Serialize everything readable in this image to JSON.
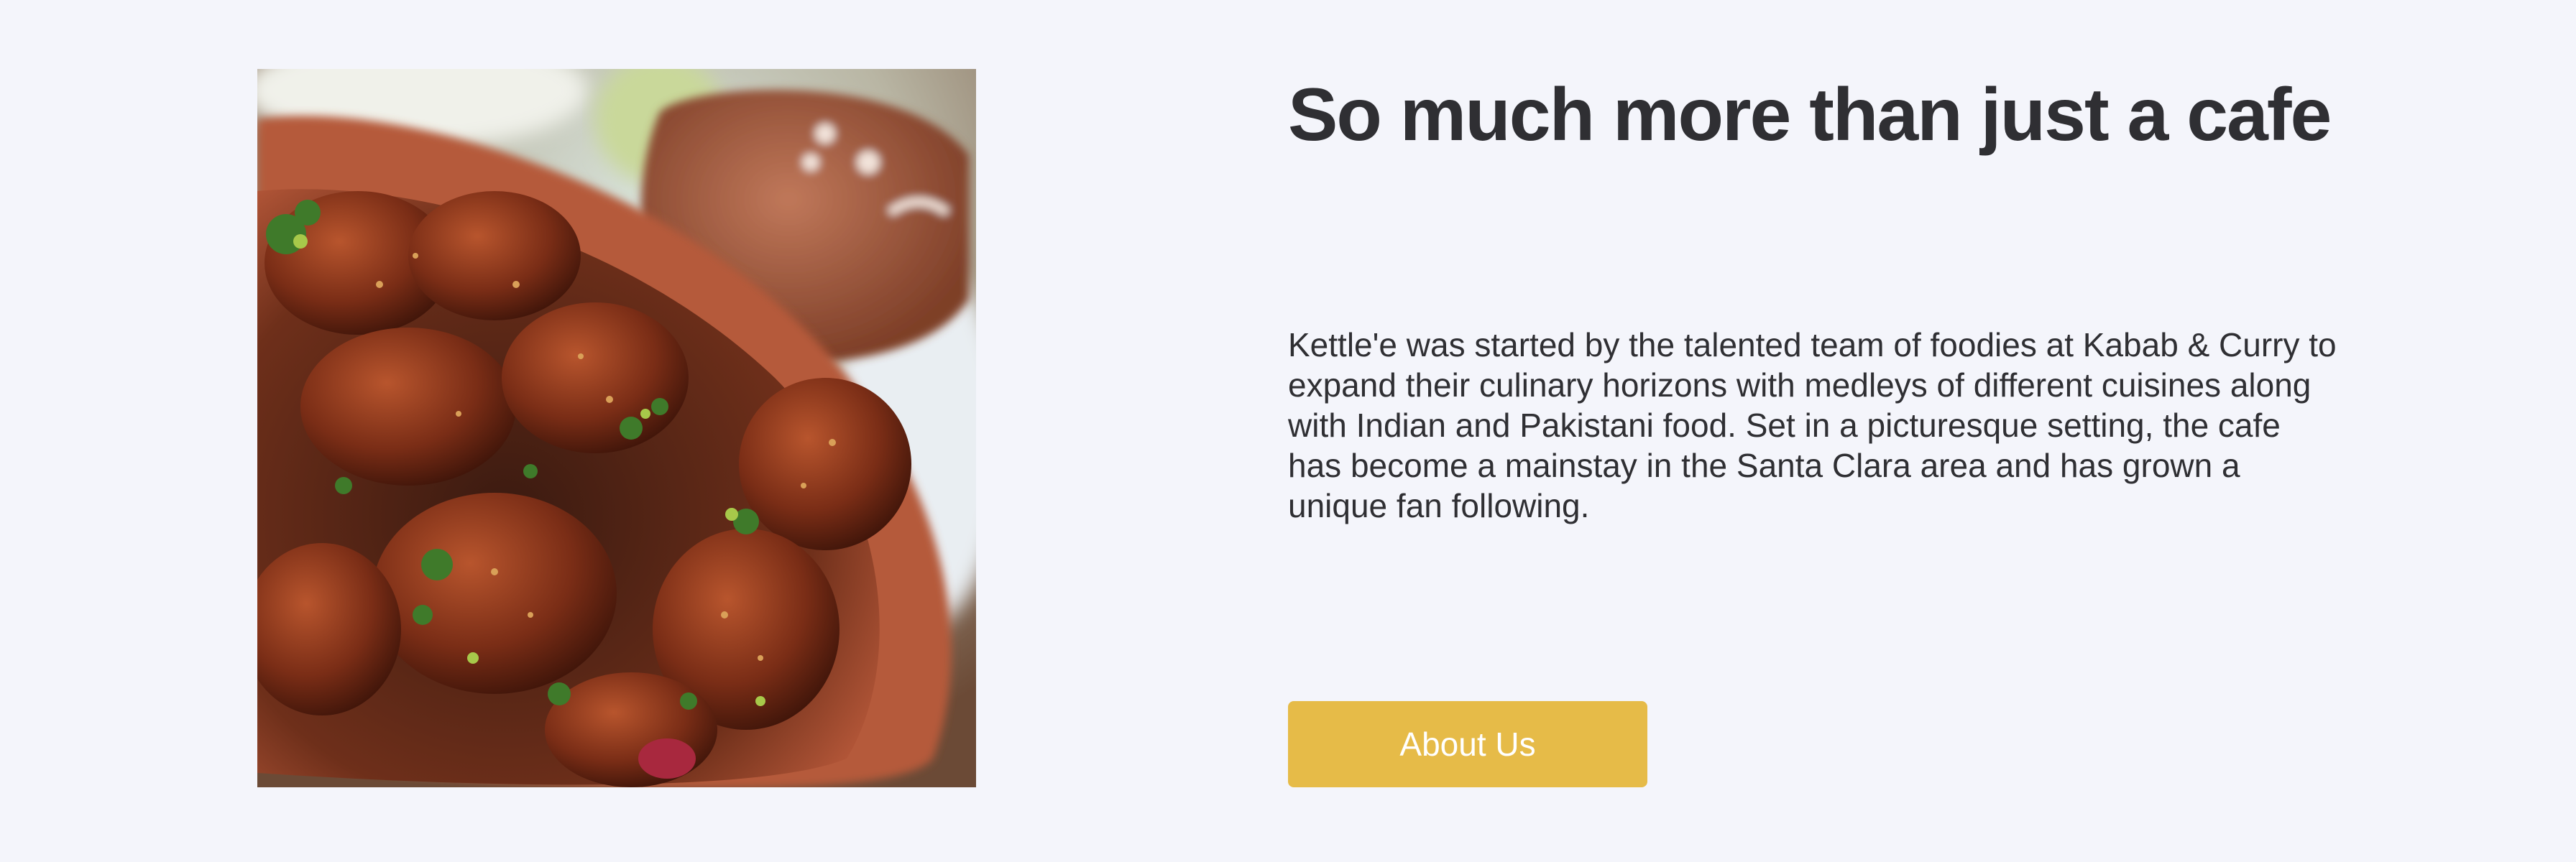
{
  "feature": {
    "image_alt": "Plate of fried pakoras with herbs in a clay dish",
    "headline": "So much more than just a cafe",
    "description": "Kettle'e was started by the talented team of foodies at Kabab & Curry to expand their culinary horizons with medleys of different cuisines along with Indian and Pakistani food. Set in a picturesque setting, the cafe has become a mainstay in the Santa Clara area and has grown a unique fan following.",
    "cta_label": "About Us"
  },
  "colors": {
    "background": "#f4f5fb",
    "text": "#2f2f33",
    "button": "#e6bb48",
    "button_text": "#ffffff"
  }
}
